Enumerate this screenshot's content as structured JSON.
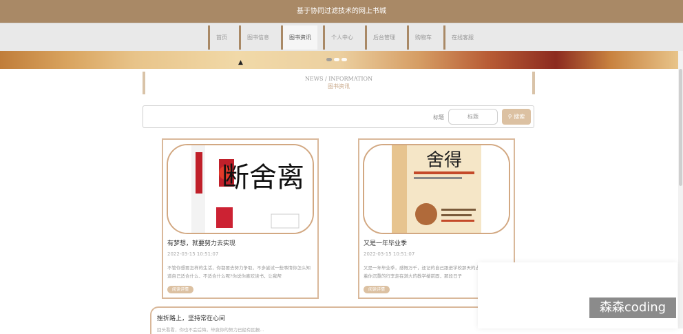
{
  "header": {
    "title": "基于协同过滤技术的网上书城"
  },
  "nav": {
    "items": [
      {
        "label": "首页"
      },
      {
        "label": "图书信息"
      },
      {
        "label": "图书资讯"
      },
      {
        "label": "个人中心"
      },
      {
        "label": "后台管理"
      },
      {
        "label": "购物车"
      },
      {
        "label": "在线客服"
      }
    ],
    "active_index": 2
  },
  "section": {
    "title_en": "NEWS / INFORMATION",
    "title_cn": "图书资讯"
  },
  "search": {
    "label": "标题",
    "placeholder": "标题",
    "button_label": "搜索",
    "button_icon": "search-icon"
  },
  "cards": [
    {
      "title": "有梦想，就要努力去实现",
      "date": "2022-03-15 10:51:07",
      "desc": "不管你想要怎样的生活，你都要去努力争取，不多尝试一些事情你怎么知道自己适合什么、不适合什么呢?你说你喜欢读书，让我帮",
      "tag": "阅读详情",
      "image_text": "断舍离"
    },
    {
      "title": "又是一年毕业季",
      "date": "2022-03-15 10:51:07",
      "desc": "又是一年毕业季，感慨万千，还记的自己跟进学校那天的忐忑与期待，拖着你沉重的行李走在满大的教学楼前面，那段日子",
      "tag": "阅读详情",
      "image_text": "舍得"
    }
  ],
  "wide_card": {
    "title": "挫折路上，坚持常在心间",
    "desc": "回头看看，你也不会后悔，毕竟你的努力已经有回报..."
  },
  "watermark": "森森coding",
  "colors": {
    "brand": "#a98966",
    "accent": "#dcc1a2",
    "border": "#d9b89a"
  }
}
